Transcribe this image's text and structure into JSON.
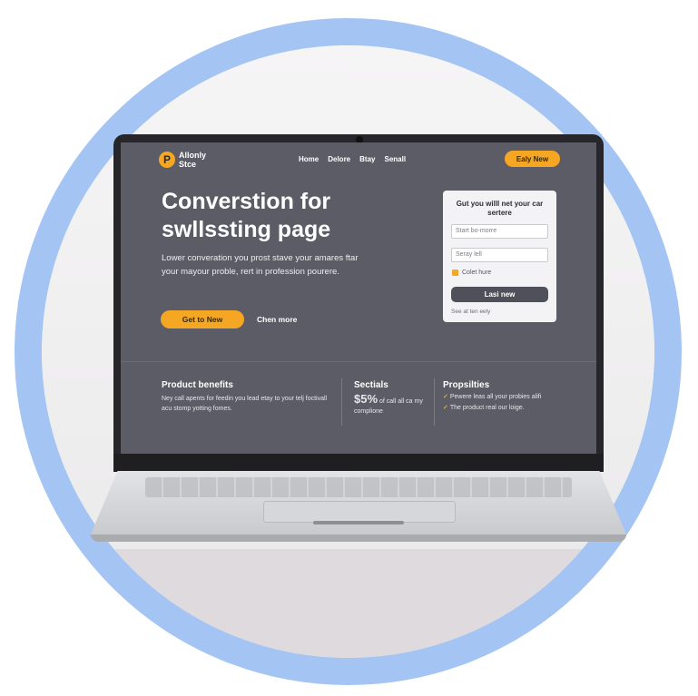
{
  "brand": {
    "mark": "P",
    "name": "Allonly\nStce"
  },
  "nav": {
    "links": [
      "Home",
      "Delore",
      "Btay",
      "Senall"
    ],
    "cta": "Ealy New"
  },
  "hero": {
    "title": "Converstion for swllssting page",
    "subtitle": "Lower converation you prost stave your amares ftar your mayour proble, rert in profession pourere.",
    "cta_primary": "Get to New",
    "cta_secondary": "Chen more"
  },
  "form": {
    "title": "Gut you willl net your car sertere",
    "field1_placeholder": "Start bo-morre",
    "field2_placeholder": "Seray lell",
    "lock_label": "Colet hure",
    "submit": "Lasi new",
    "footnote": "See at ten eely"
  },
  "benefits": {
    "col1_title": "Product benefits",
    "col1_text": "Ney call apents for feedin you lead etay to your telj foctivall acu stomp yotting fomes.",
    "col2_title": "Sectials",
    "col2_big": "$5%",
    "col2_text": "of call all ca my complione",
    "col3_title": "Propsilties",
    "col3_items": [
      "Pewere leas all your probies alifi",
      "The product real our loige."
    ]
  },
  "colors": {
    "accent": "#f5a623",
    "screen_bg": "#5b5c66",
    "ring": "#a4c4f4"
  }
}
